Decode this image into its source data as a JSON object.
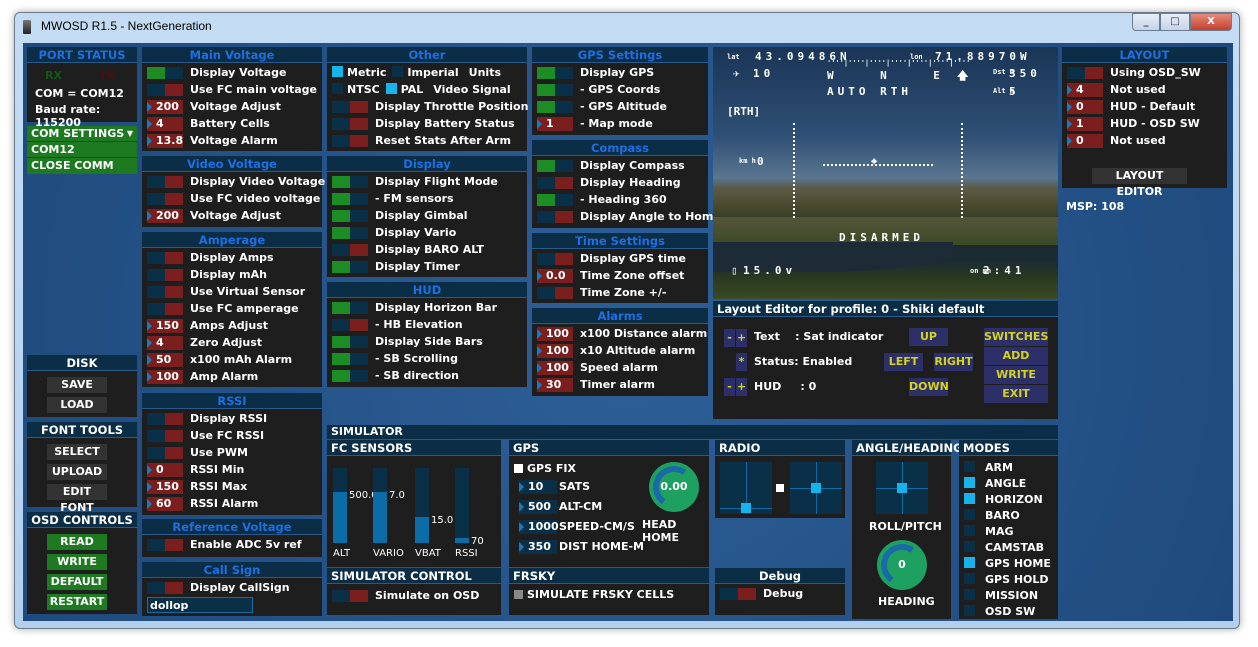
{
  "window": {
    "title": "MWOSD R1.5 - NextGeneration",
    "min": "_",
    "max": "□",
    "close": "X"
  },
  "port_status": {
    "title": "PORT STATUS",
    "rx": "RX",
    "tx": "TX",
    "com": "COM = COM12",
    "baud": "Baud rate: 115200"
  },
  "com_menu": {
    "items": [
      "COM SETTINGS",
      "COM12",
      "CLOSE COMM"
    ]
  },
  "disk": {
    "title": "DISK",
    "buttons": [
      "SAVE",
      "LOAD"
    ]
  },
  "font_tools": {
    "title": "FONT TOOLS",
    "buttons": [
      "SELECT",
      "UPLOAD",
      "EDIT FONT"
    ]
  },
  "osd_controls": {
    "title": "OSD CONTROLS",
    "buttons": [
      "READ",
      "WRITE",
      "DEFAULT",
      "RESTART"
    ]
  },
  "panels": {
    "main_voltage": {
      "title": "Main Voltage",
      "rows": [
        {
          "t": "toggle",
          "on": true,
          "label": "Display Voltage"
        },
        {
          "t": "toggle",
          "on": false,
          "label": "Use FC main voltage"
        },
        {
          "t": "value",
          "value": "200",
          "label": "Voltage Adjust"
        },
        {
          "t": "value",
          "value": "4",
          "label": "Battery Cells"
        },
        {
          "t": "value",
          "value": "13.8",
          "label": "Voltage Alarm"
        }
      ]
    },
    "video_voltage": {
      "title": "Video Voltage",
      "rows": [
        {
          "t": "toggle",
          "on": false,
          "label": "Display Video Voltage"
        },
        {
          "t": "toggle",
          "on": false,
          "label": "Use FC video voltage"
        },
        {
          "t": "value",
          "value": "200",
          "label": "Voltage Adjust"
        }
      ]
    },
    "amperage": {
      "title": "Amperage",
      "rows": [
        {
          "t": "toggle",
          "on": false,
          "label": "Display Amps"
        },
        {
          "t": "toggle",
          "on": false,
          "label": "Display mAh"
        },
        {
          "t": "toggle",
          "on": false,
          "label": "Use Virtual Sensor"
        },
        {
          "t": "toggle",
          "on": false,
          "label": "Use FC amperage"
        },
        {
          "t": "value",
          "value": "150",
          "label": "Amps Adjust"
        },
        {
          "t": "value",
          "value": "4",
          "label": "Zero Adjust"
        },
        {
          "t": "value",
          "value": "50",
          "label": "x100 mAh Alarm"
        },
        {
          "t": "value",
          "value": "100",
          "label": "Amp Alarm"
        }
      ]
    },
    "rssi": {
      "title": "RSSI",
      "rows": [
        {
          "t": "toggle",
          "on": false,
          "label": "Display RSSI"
        },
        {
          "t": "toggle",
          "on": false,
          "label": "Use FC RSSI"
        },
        {
          "t": "toggle",
          "on": false,
          "label": "Use PWM"
        },
        {
          "t": "value",
          "value": "0",
          "label": "RSSI Min"
        },
        {
          "t": "value",
          "value": "150",
          "label": "RSSI Max"
        },
        {
          "t": "value",
          "value": "60",
          "label": "RSSI Alarm"
        }
      ]
    },
    "ref_voltage": {
      "title": "Reference Voltage",
      "rows": [
        {
          "t": "toggle",
          "on": false,
          "label": "Enable ADC 5v ref"
        }
      ]
    },
    "call_sign": {
      "title": "Call Sign",
      "rows": [
        {
          "t": "toggle",
          "on": false,
          "label": "Display CallSign"
        },
        {
          "t": "input",
          "value": "dollop"
        }
      ]
    },
    "other": {
      "title": "Other",
      "rows": [
        {
          "t": "radio",
          "options": [
            {
              "label": "Metric",
              "on": true
            },
            {
              "label": "Imperial",
              "on": false
            }
          ],
          "label": "Units"
        },
        {
          "t": "radio",
          "options": [
            {
              "label": "NTSC",
              "on": false
            },
            {
              "label": "PAL",
              "on": true
            }
          ],
          "label": "Video Signal"
        },
        {
          "t": "toggle",
          "on": false,
          "label": "Display Throttle Position"
        },
        {
          "t": "toggle",
          "on": false,
          "label": "Display Battery Status"
        },
        {
          "t": "toggle",
          "on": false,
          "label": "Reset Stats After Arm"
        }
      ]
    },
    "display": {
      "title": "Display",
      "rows": [
        {
          "t": "toggle",
          "on": true,
          "label": "Display Flight Mode"
        },
        {
          "t": "toggle",
          "on": true,
          "label": " - FM sensors"
        },
        {
          "t": "toggle",
          "on": true,
          "label": "Display Gimbal"
        },
        {
          "t": "toggle",
          "on": true,
          "label": "Display Vario"
        },
        {
          "t": "toggle",
          "on": false,
          "label": "Display BARO ALT"
        },
        {
          "t": "toggle",
          "on": true,
          "label": "Display Timer"
        }
      ]
    },
    "hud": {
      "title": "HUD",
      "rows": [
        {
          "t": "toggle",
          "on": true,
          "label": "Display Horizon Bar"
        },
        {
          "t": "toggle",
          "on": false,
          "label": " - HB Elevation"
        },
        {
          "t": "toggle",
          "on": true,
          "label": "Display Side Bars"
        },
        {
          "t": "toggle",
          "on": true,
          "label": " - SB Scrolling"
        },
        {
          "t": "toggle",
          "on": true,
          "label": " - SB direction"
        }
      ]
    },
    "gps_settings": {
      "title": "GPS Settings",
      "rows": [
        {
          "t": "toggle",
          "on": true,
          "label": "Display GPS"
        },
        {
          "t": "toggle",
          "on": true,
          "label": " - GPS Coords"
        },
        {
          "t": "toggle",
          "on": true,
          "label": " - GPS Altitude"
        },
        {
          "t": "value",
          "value": "1",
          "label": " - Map mode"
        }
      ]
    },
    "compass": {
      "title": "Compass",
      "rows": [
        {
          "t": "toggle",
          "on": true,
          "label": "Display Compass"
        },
        {
          "t": "toggle",
          "on": false,
          "label": "Display Heading"
        },
        {
          "t": "toggle",
          "on": true,
          "label": " - Heading 360"
        },
        {
          "t": "toggle",
          "on": false,
          "label": "Display Angle to Home"
        }
      ]
    },
    "time_settings": {
      "title": "Time Settings",
      "rows": [
        {
          "t": "toggle",
          "on": false,
          "label": "Display GPS time"
        },
        {
          "t": "value",
          "value": "0.0",
          "label": "Time Zone offset"
        },
        {
          "t": "toggle",
          "on": false,
          "label": "Time Zone +/-"
        }
      ]
    },
    "alarms": {
      "title": "Alarms",
      "rows": [
        {
          "t": "value",
          "value": "100",
          "label": "x100 Distance alarm"
        },
        {
          "t": "value",
          "value": "100",
          "label": "x10   Altitude alarm"
        },
        {
          "t": "value",
          "value": "100",
          "label": "Speed alarm"
        },
        {
          "t": "value",
          "value": "30",
          "label": "Timer alarm"
        }
      ]
    },
    "layout": {
      "title": "LAYOUT",
      "rows": [
        {
          "t": "toggle",
          "on": false,
          "label": "Using OSD_SW"
        },
        {
          "t": "value",
          "value": "4",
          "label": "Not used"
        },
        {
          "t": "value",
          "value": "0",
          "label": "HUD - Default"
        },
        {
          "t": "value",
          "value": "1",
          "label": "HUD - OSD SW"
        },
        {
          "t": "value",
          "value": "0",
          "label": "Not used"
        }
      ]
    }
  },
  "layout_extra": {
    "editor_button": "LAYOUT EDITOR",
    "msp": "MSP: 108"
  },
  "osd": {
    "lat_label": "lat",
    "lat": "43.09486N",
    "lon_label": "lon",
    "lon": "71.88970W",
    "sats": "10",
    "compass": "W    N    E",
    "dst": "350",
    "dst_label": "Dst m",
    "mode": "AUTO RTH",
    "alt": "5",
    "alt_label": "Alt m",
    "rth": "[RTH]",
    "speed": "0",
    "speed_label": "km h",
    "status": "DISARMED",
    "battery": "15.0v",
    "timer": "2:41",
    "timer_label": "on mn"
  },
  "layout_editor": {
    "title": "Layout Editor for profile: 0 - Shiki default",
    "minus": "-",
    "plus": "+",
    "star": "*",
    "text": "Text    : Sat indicator",
    "status": "Status: Enabled",
    "hud": "HUD     : 0",
    "up": "UP",
    "left": "LEFT",
    "right": "RIGHT",
    "down": "DOWN",
    "switches": "SWITCHES",
    "add": "ADD",
    "write": "WRITE",
    "exit": "EXIT"
  },
  "simulator": {
    "title": "SIMULATOR",
    "fc_sensors": {
      "title": "FC SENSORS",
      "bars": [
        {
          "label": "ALT",
          "value": "500.0",
          "fill": 0.68
        },
        {
          "label": "VARIO",
          "value": "7.0",
          "fill": 0.68
        },
        {
          "label": "VBAT",
          "value": "15.0",
          "fill": 0.35
        },
        {
          "label": "RSSI",
          "value": "70",
          "fill": 0.07
        }
      ]
    },
    "gps": {
      "title": "GPS",
      "fix": "GPS FIX",
      "fields": [
        {
          "value": "10",
          "label": "SATS"
        },
        {
          "value": "500",
          "label": "ALT-CM"
        },
        {
          "value": "1000",
          "label": "SPEED-CM/S"
        },
        {
          "value": "350",
          "label": "DIST HOME-M"
        }
      ],
      "head_home": "0.00",
      "head_home_label": "HEAD HOME"
    },
    "radio": {
      "title": "RADIO"
    },
    "angle": {
      "title": "ANGLE/HEADING",
      "roll_pitch": "ROLL/PITCH",
      "heading": "0",
      "heading_label": "HEADING"
    },
    "modes": {
      "title": "MODES",
      "items": [
        {
          "label": "ARM",
          "on": false
        },
        {
          "label": "ANGLE",
          "on": true
        },
        {
          "label": "HORIZON",
          "on": true
        },
        {
          "label": "BARO",
          "on": false
        },
        {
          "label": "MAG",
          "on": false
        },
        {
          "label": "CAMSTAB",
          "on": false
        },
        {
          "label": "GPS HOME",
          "on": true
        },
        {
          "label": "GPS HOLD",
          "on": false
        },
        {
          "label": "MISSION",
          "on": false
        },
        {
          "label": "OSD SW",
          "on": false
        }
      ]
    },
    "control": {
      "title": "SIMULATOR CONTROL",
      "label": "Simulate on OSD"
    },
    "frsky": {
      "title": "FRSKY",
      "label": "SIMULATE FRSKY CELLS"
    },
    "debug": {
      "title": "Debug",
      "label": "Debug"
    }
  },
  "colors": {
    "panel": "#1e1e1e",
    "header_text": "#1f6fe0",
    "toggle_on": "#1e8c24",
    "toggle_off": "#7a1e1e",
    "mode_on": "#16b4ea",
    "editor_text": "#d4d418"
  }
}
